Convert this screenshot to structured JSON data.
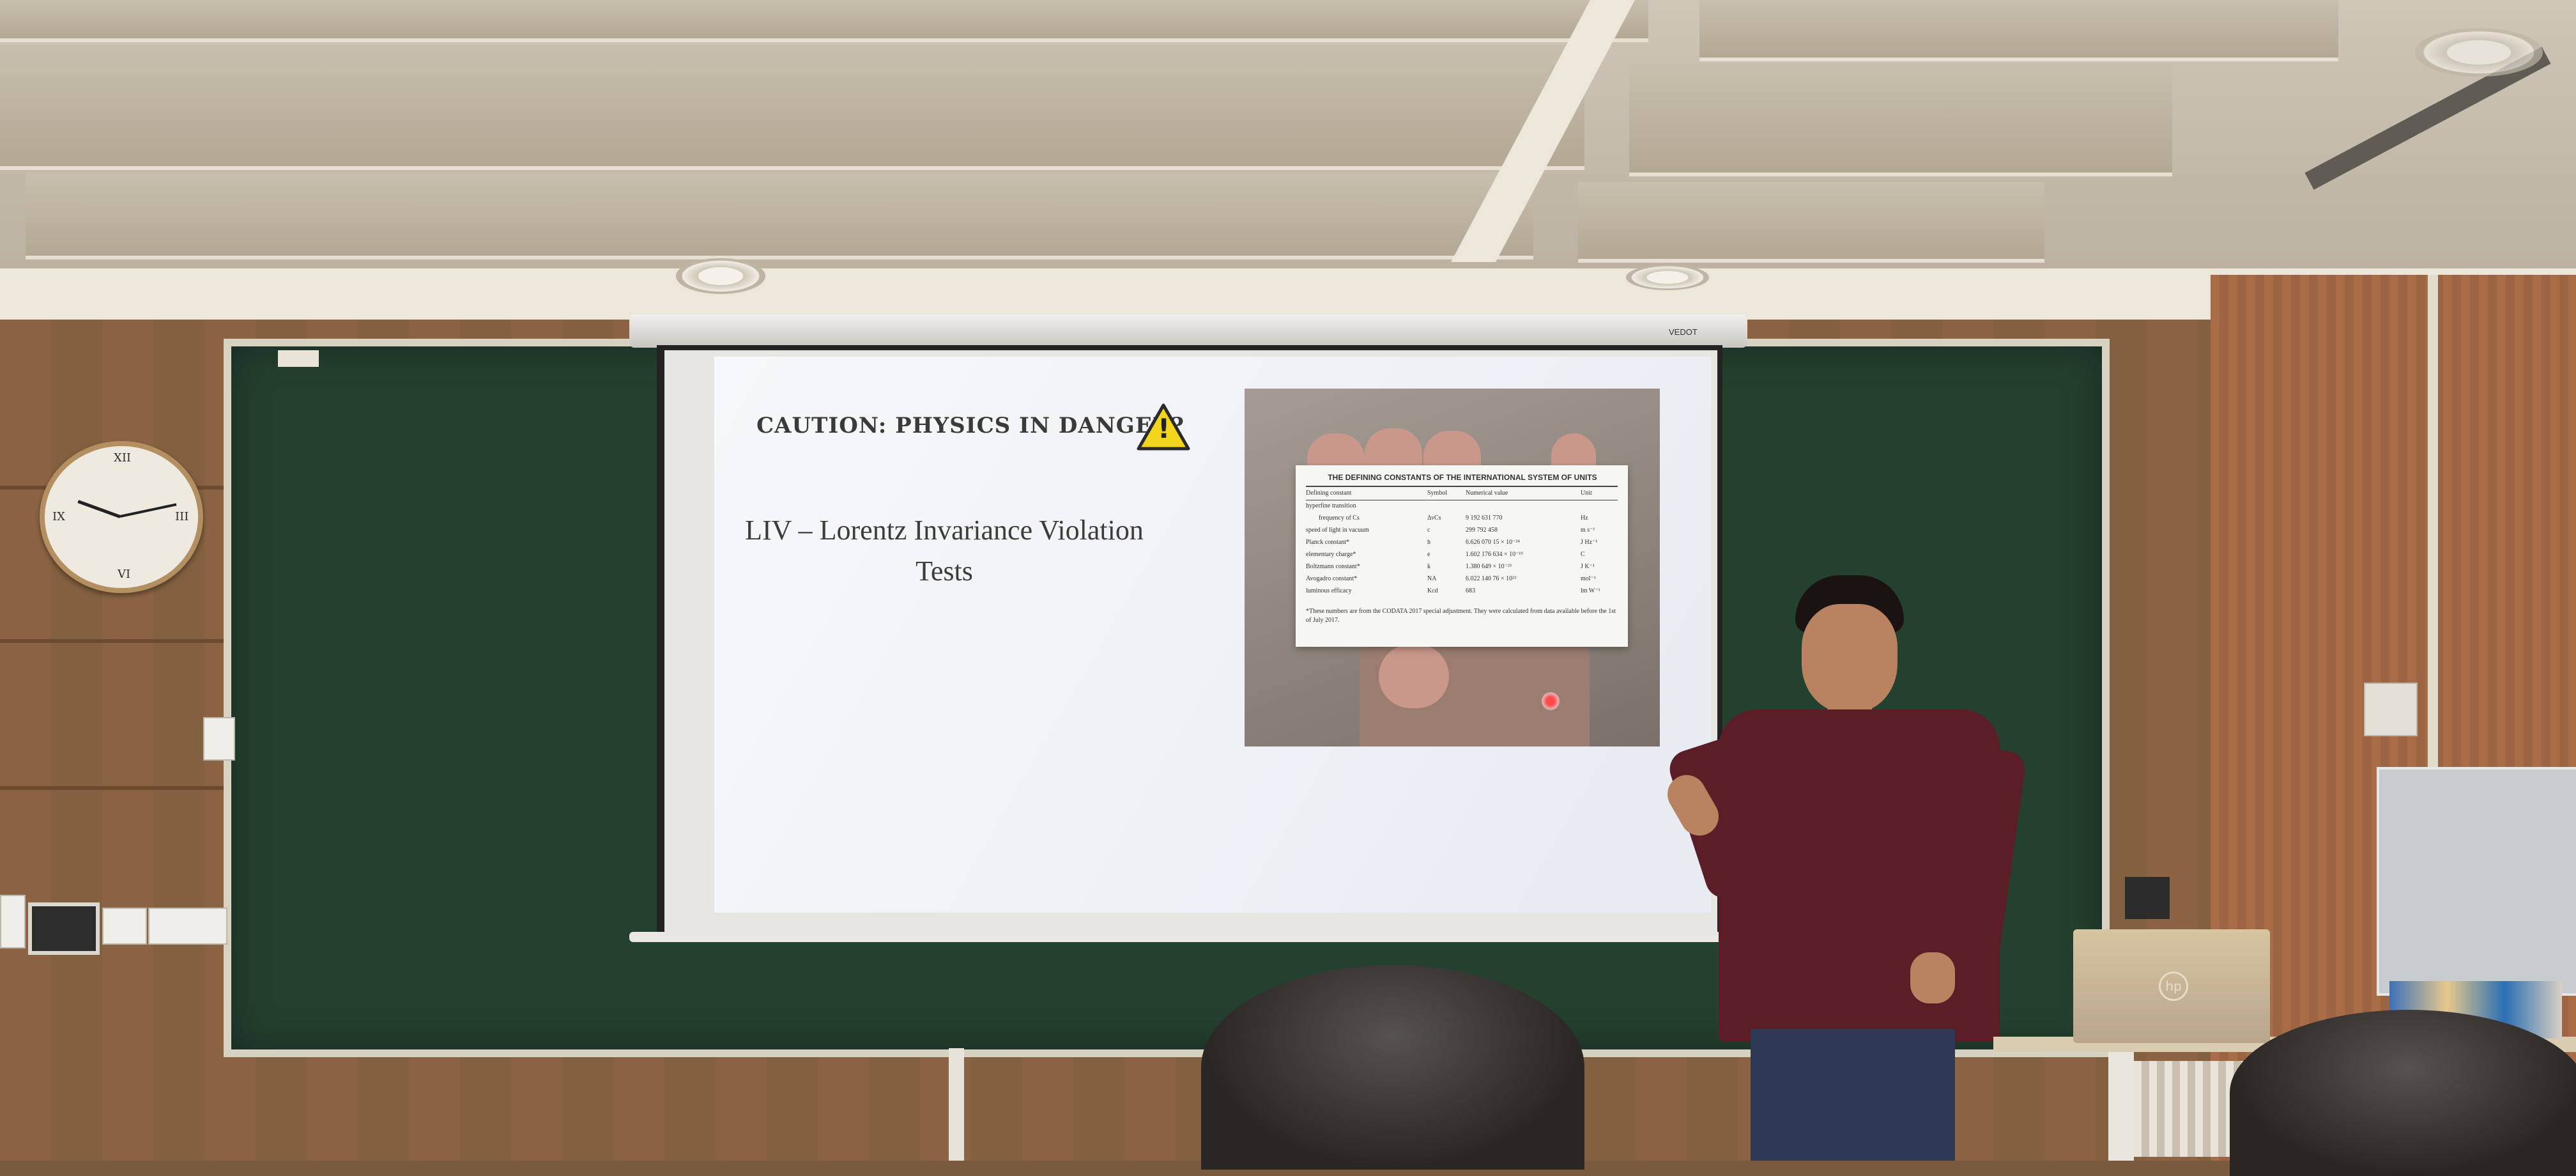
{
  "slide": {
    "title": "CAUTION: PHYSICS IN DANGER?",
    "warning_symbol": "!",
    "main_text_line1": "LIV – Lorentz Invariance Violation",
    "main_text_line2": "Tests"
  },
  "card": {
    "title": "THE DEFINING CONSTANTS OF THE INTERNATIONAL SYSTEM OF UNITS",
    "header": [
      "Defining constant",
      "Symbol",
      "Numerical value",
      "Unit"
    ],
    "rows": [
      [
        "hyperfine transition",
        "",
        "",
        ""
      ],
      [
        "frequency of Cs",
        "ΔνCs",
        "9 192 631 770",
        "Hz"
      ],
      [
        "speed of light in vacuum",
        "c",
        "299 792 458",
        "m s⁻¹"
      ],
      [
        "Planck constant*",
        "h",
        "6.626 070 15 × 10⁻³⁴",
        "J Hz⁻¹"
      ],
      [
        "elementary charge*",
        "e",
        "1.602 176 634 × 10⁻¹⁹",
        "C"
      ],
      [
        "Boltzmann constant*",
        "k",
        "1.380 649 × 10⁻²³",
        "J K⁻¹"
      ],
      [
        "Avogadro constant*",
        "NA",
        "6.022 140 76 × 10²³",
        "mol⁻¹"
      ],
      [
        "luminous efficacy",
        "Kcd",
        "683",
        "lm W⁻¹"
      ]
    ],
    "note": "*These numbers are from the CODATA 2017 special adjustment. They were calculated from data available before the 1st of July 2017."
  },
  "screen_brand": "VEDOT",
  "laptop_logo": "hp",
  "colors": {
    "board": "#24402f",
    "shirt": "#5b1e27",
    "warning": "#f2d51c"
  }
}
